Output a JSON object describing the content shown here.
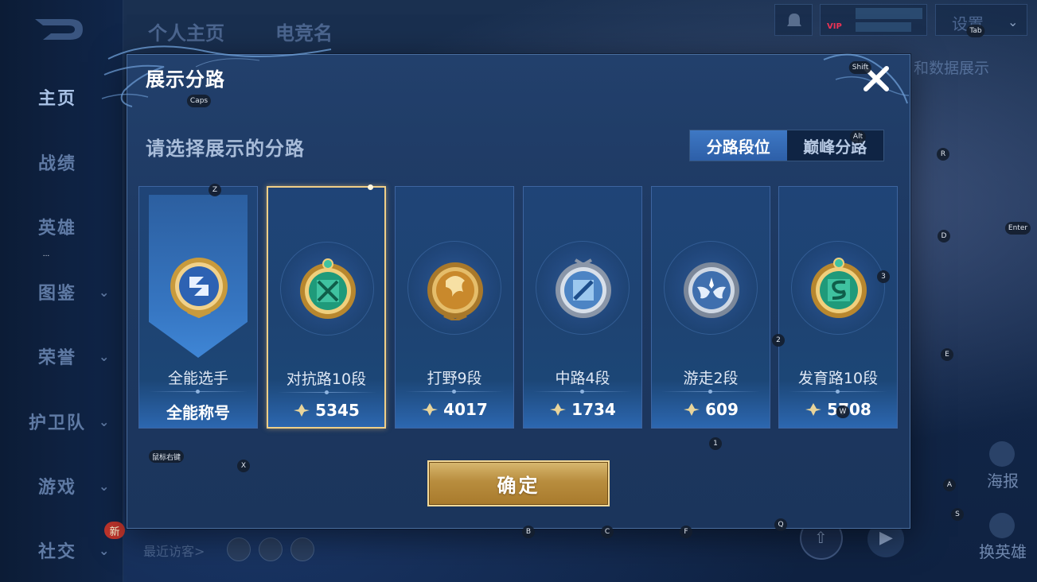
{
  "background": {
    "nav_items": [
      {
        "label": "主页",
        "active": true
      },
      {
        "label": "战绩"
      },
      {
        "label": "英雄"
      },
      {
        "label": "图鉴",
        "chevron": true
      },
      {
        "label": "荣誉",
        "chevron": true
      },
      {
        "label": "护卫队",
        "chevron": true
      },
      {
        "label": "游戏",
        "chevron": true
      },
      {
        "label": "社交",
        "chevron": true
      }
    ],
    "new_badge": "新",
    "top_tabs": [
      "个人主页",
      "电竞名"
    ],
    "settings_label": "设置",
    "vip_label": "VIP",
    "data_display_label": "和数据展示",
    "recent_visitors": "最近访客>",
    "poster_label": "海报",
    "change_hero_label": "换英雄"
  },
  "modal": {
    "title": "展示分路",
    "subtitle": "请选择展示的分路",
    "toggle": {
      "left": "分路段位",
      "right": "巅峰分路",
      "selected": "left"
    },
    "cards": [
      {
        "name": "全能选手",
        "score": "全能称号",
        "type": "allround",
        "selected": false
      },
      {
        "name": "对抗路10段",
        "score": "5345",
        "type": "clash",
        "selected": true
      },
      {
        "name": "打野9段",
        "score": "4017",
        "type": "jungle",
        "selected": false
      },
      {
        "name": "中路4段",
        "score": "1734",
        "type": "mid",
        "selected": false
      },
      {
        "name": "游走2段",
        "score": "609",
        "type": "roam",
        "selected": false
      },
      {
        "name": "发育路10段",
        "score": "5708",
        "type": "farm",
        "selected": false
      }
    ],
    "confirm_label": "确定"
  },
  "key_hints": [
    {
      "label": "Tab"
    },
    {
      "label": "Shift"
    },
    {
      "label": "Caps"
    },
    {
      "label": "Alt"
    },
    {
      "label": "R"
    },
    {
      "label": "Z"
    },
    {
      "label": "D"
    },
    {
      "label": "Enter"
    },
    {
      "label": "3"
    },
    {
      "label": "2"
    },
    {
      "label": "E"
    },
    {
      "label": "W"
    },
    {
      "label": "1"
    },
    {
      "label": "鼠标右键"
    },
    {
      "label": "X"
    },
    {
      "label": "A"
    },
    {
      "label": "S"
    },
    {
      "label": "Q"
    },
    {
      "label": "B"
    },
    {
      "label": "C"
    },
    {
      "label": "F"
    },
    {
      "label": "..."
    }
  ]
}
